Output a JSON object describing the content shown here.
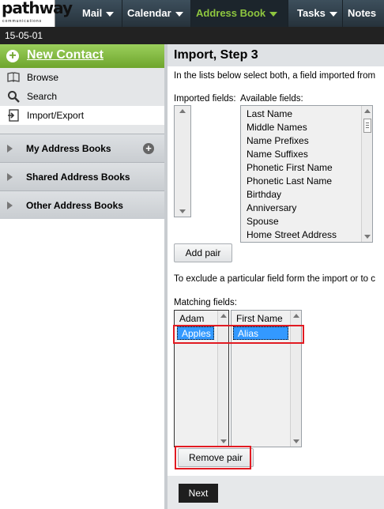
{
  "app": {
    "logo_text": "pathway",
    "logo_sub": "communications"
  },
  "nav": {
    "items": [
      {
        "label": "Mail",
        "active": false
      },
      {
        "label": "Calendar",
        "active": false
      },
      {
        "label": "Address Book",
        "active": true
      },
      {
        "label": "Tasks",
        "active": false
      },
      {
        "label": "Notes",
        "active": false
      }
    ],
    "date": "15-05-01",
    "accent_color": "#8ec63f"
  },
  "sidebar": {
    "new_contact": "New Contact",
    "links": [
      {
        "label": "Browse",
        "icon": "book-icon"
      },
      {
        "label": "Search",
        "icon": "search-icon"
      },
      {
        "label": "Import/Export",
        "icon": "import-export-icon"
      }
    ],
    "sections": [
      {
        "label": "My Address Books"
      },
      {
        "label": "Shared Address Books"
      },
      {
        "label": "Other Address Books"
      }
    ]
  },
  "main": {
    "title": "Import, Step 3",
    "instruction": "In the lists below select both, a field imported from",
    "imported_label": "Imported fields:",
    "available_label": "Available fields:",
    "available_fields": [
      "Last Name",
      "Middle Names",
      "Name Prefixes",
      "Name Suffixes",
      "Phonetic First Name",
      "Phonetic Last Name",
      "Birthday",
      "Anniversary",
      "Spouse",
      "Home Street Address"
    ],
    "add_pair": "Add pair",
    "exclude_text": "To exclude a particular field form the import or to c",
    "matching_label": "Matching fields:",
    "matching": {
      "left_header": "Adam",
      "right_header": "First Name",
      "left_value": "Apples",
      "right_value": "Alias"
    },
    "remove_pair": "Remove pair",
    "next": "Next",
    "highlight_color": "#e11b22"
  }
}
